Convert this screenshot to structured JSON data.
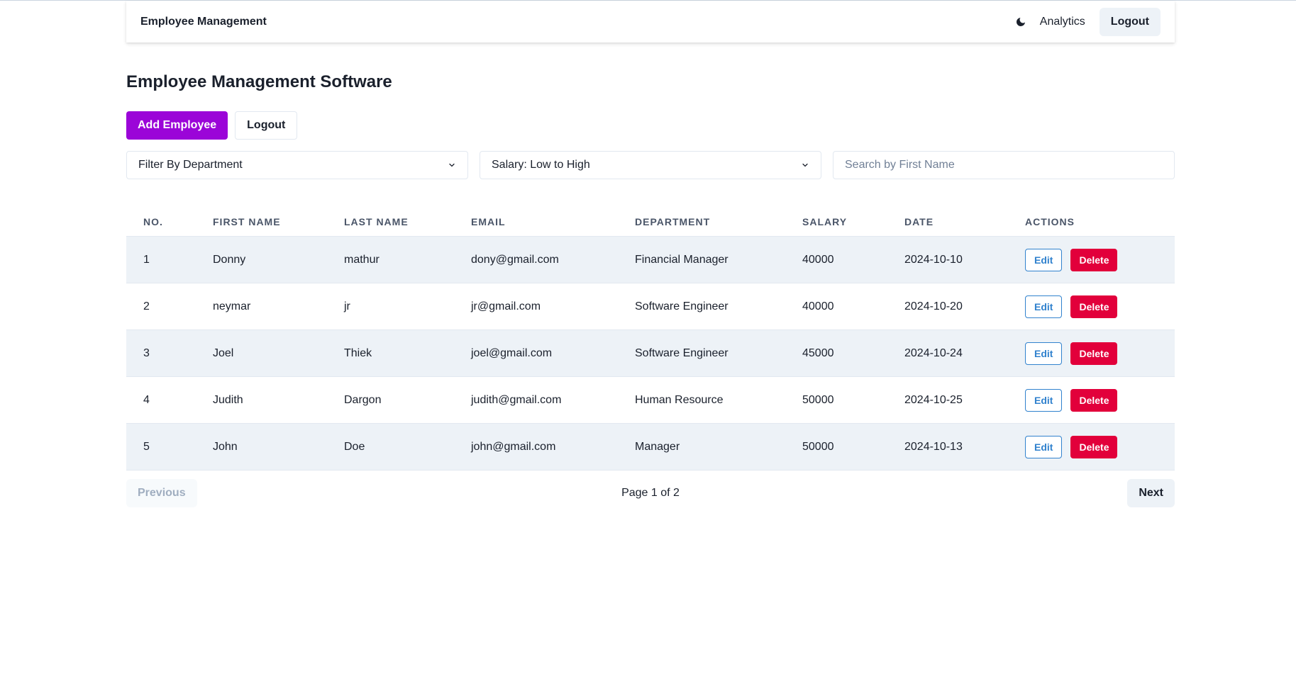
{
  "navbar": {
    "brand": "Employee Management",
    "theme_icon": "moon-icon",
    "analytics_label": "Analytics",
    "logout_label": "Logout"
  },
  "page": {
    "title": "Employee Management Software",
    "add_button": "Add Employee",
    "logout_button": "Logout"
  },
  "filters": {
    "department_selected": "Filter By Department",
    "salary_sort_selected": "Salary: Low to High",
    "search_placeholder": "Search by First Name",
    "search_value": ""
  },
  "table": {
    "headers": [
      "NO.",
      "FIRST NAME",
      "LAST NAME",
      "EMAIL",
      "DEPARTMENT",
      "SALARY",
      "DATE",
      "ACTIONS"
    ],
    "rows": [
      {
        "no": "1",
        "first": "Donny",
        "last": "mathur",
        "email": "dony@gmail.com",
        "department": "Financial Manager",
        "salary": "40000",
        "date": "2024-10-10"
      },
      {
        "no": "2",
        "first": "neymar",
        "last": "jr",
        "email": "jr@gmail.com",
        "department": "Software Engineer",
        "salary": "40000",
        "date": "2024-10-20"
      },
      {
        "no": "3",
        "first": "Joel",
        "last": "Thiek",
        "email": "joel@gmail.com",
        "department": "Software Engineer",
        "salary": "45000",
        "date": "2024-10-24"
      },
      {
        "no": "4",
        "first": "Judith",
        "last": "Dargon",
        "email": "judith@gmail.com",
        "department": "Human Resource",
        "salary": "50000",
        "date": "2024-10-25"
      },
      {
        "no": "5",
        "first": "John",
        "last": "Doe",
        "email": "john@gmail.com",
        "department": "Manager",
        "salary": "50000",
        "date": "2024-10-13"
      }
    ],
    "edit_label": "Edit",
    "delete_label": "Delete"
  },
  "pagination": {
    "previous_label": "Previous",
    "page_info": "Page 1 of 2",
    "next_label": "Next"
  },
  "colors": {
    "primary": "#9b05d8",
    "danger": "#e2003b",
    "edit": "#3182ce",
    "stripe": "#edf2f7"
  }
}
